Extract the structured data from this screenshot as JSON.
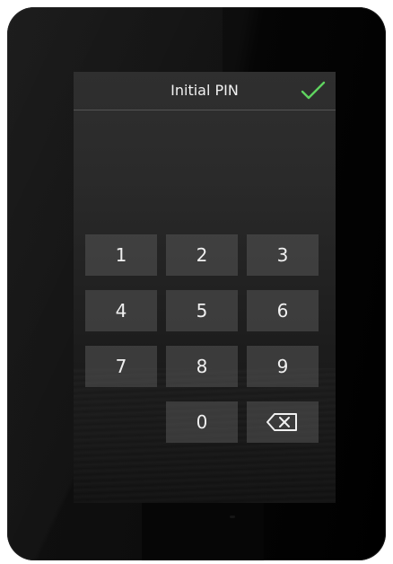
{
  "screen": {
    "title": "Initial PIN",
    "confirm_icon": "checkmark-icon",
    "accent_color": "#5fd35f",
    "pin_value": ""
  },
  "keypad": {
    "keys": [
      "1",
      "2",
      "3",
      "4",
      "5",
      "6",
      "7",
      "8",
      "9",
      "0"
    ],
    "backspace_icon": "backspace-icon"
  }
}
